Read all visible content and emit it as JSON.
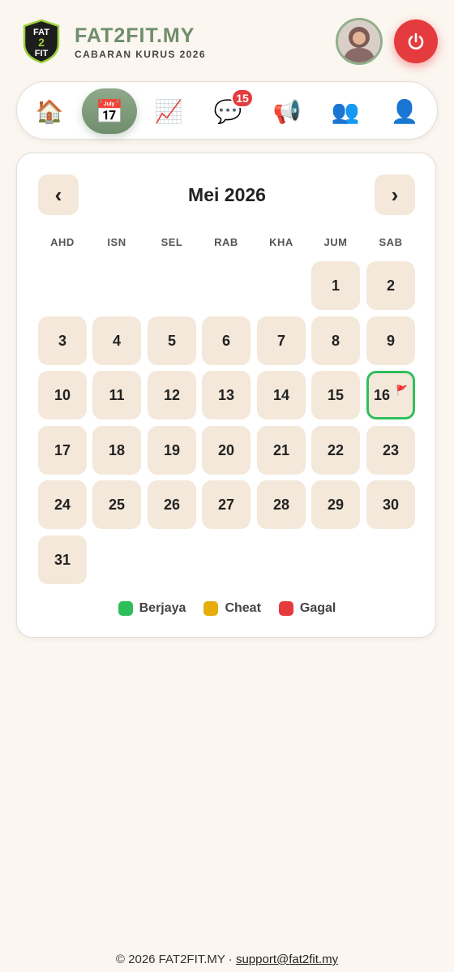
{
  "header": {
    "brand_title": "FAT2FIT.MY",
    "brand_subtitle": "CABARAN KURUS 2026",
    "logo_text_top": "FAT",
    "logo_text_mid": "2",
    "logo_text_bottom": "FIT"
  },
  "nav": {
    "items": [
      {
        "name": "home",
        "icon": "house-icon",
        "glyph": "🏠"
      },
      {
        "name": "calendar",
        "icon": "calendar-icon",
        "glyph": "📅",
        "active": true
      },
      {
        "name": "progress",
        "icon": "chart-icon",
        "glyph": "📈"
      },
      {
        "name": "chat",
        "icon": "speech-bubble-icon",
        "glyph": "💬",
        "badge": "15"
      },
      {
        "name": "announcements",
        "icon": "megaphone-icon",
        "glyph": "📢"
      },
      {
        "name": "community",
        "icon": "users-icon",
        "glyph": "👥"
      },
      {
        "name": "profile",
        "icon": "user-icon",
        "glyph": "👤"
      }
    ]
  },
  "calendar": {
    "month_title": "Mei 2026",
    "prev_label": "‹",
    "next_label": "›",
    "weekdays": [
      "AHD",
      "ISN",
      "SEL",
      "RAB",
      "KHA",
      "JUM",
      "SAB"
    ],
    "days": [
      "1",
      "2",
      "3",
      "4",
      "5",
      "6",
      "7",
      "8",
      "9",
      "10",
      "11",
      "12",
      "13",
      "14",
      "15",
      "16",
      "17",
      "18",
      "19",
      "20",
      "21",
      "22",
      "23",
      "24",
      "25",
      "26",
      "27",
      "28",
      "29",
      "30",
      "31"
    ],
    "today": "16",
    "today_flag": "🚩"
  },
  "legend": [
    {
      "label": "Berjaya",
      "color": "#2fbf5a"
    },
    {
      "label": "Cheat",
      "color": "#e6ad0c"
    },
    {
      "label": "Gagal",
      "color": "#e53b3f"
    }
  ],
  "footer": {
    "copyright": "© 2026 FAT2FIT.MY · ",
    "email": "support@fat2fit.my"
  },
  "colors": {
    "accent": "#6f8e6c",
    "background": "#fcf6f0",
    "day_cell": "#f3e8da",
    "danger": "#e53b3f"
  }
}
